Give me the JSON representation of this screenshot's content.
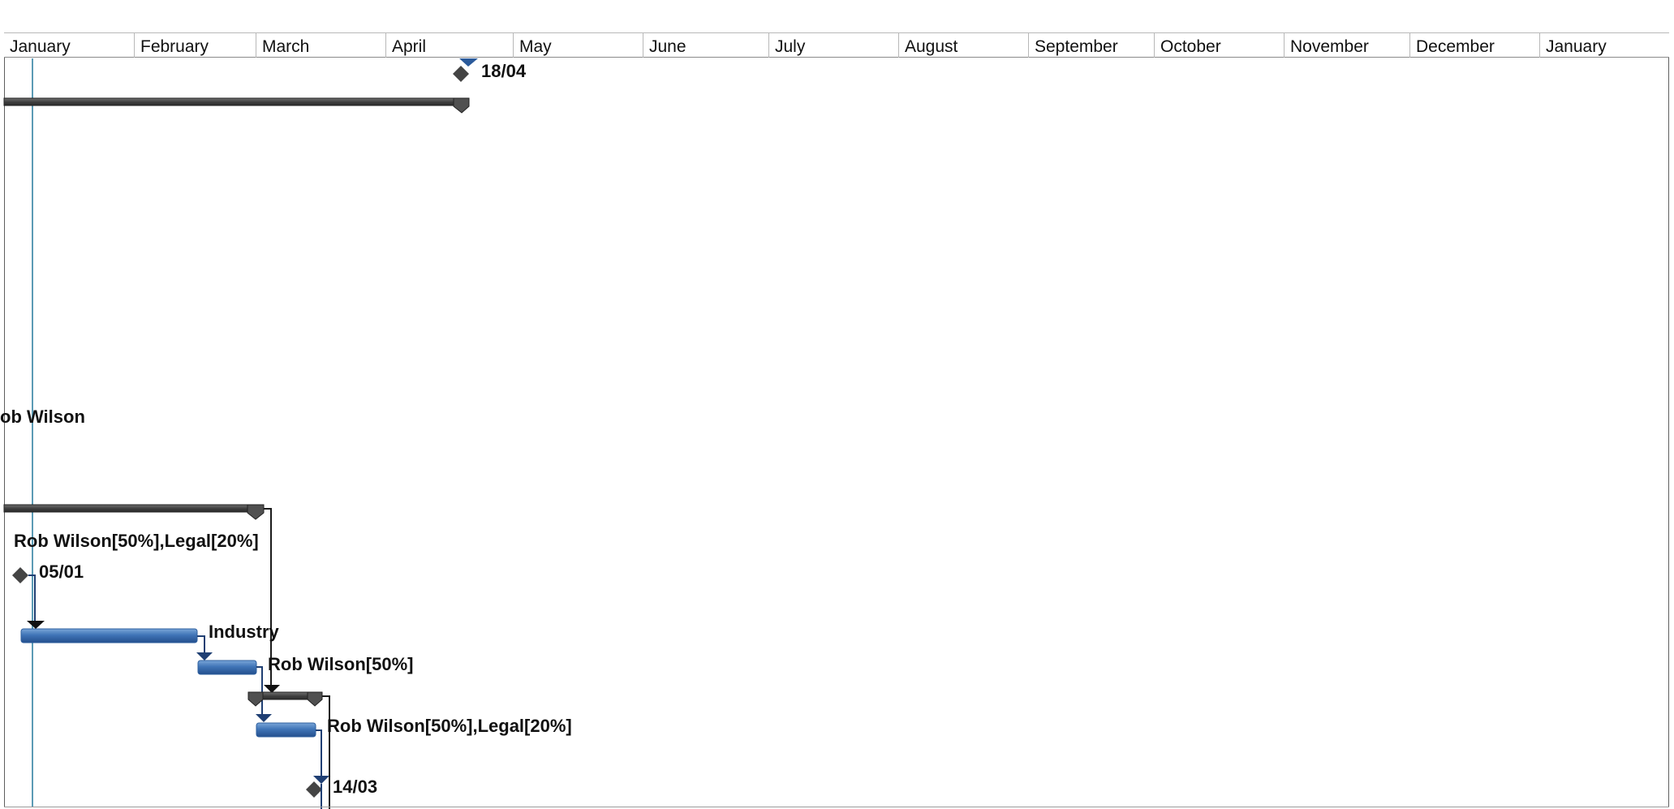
{
  "timeline": {
    "months": [
      "January",
      "February",
      "March",
      "April",
      "May",
      "June",
      "July",
      "August",
      "September",
      "October",
      "November",
      "December",
      "January"
    ]
  },
  "labels": {
    "milestone_top": "18/04",
    "partial_resource": "ob Wilson",
    "summary_resource": "Rob Wilson[50%],Legal[20%]",
    "milestone_start": "05/01",
    "task_industry": "Industry",
    "task_rob_half": "Rob Wilson[50%]",
    "task_rob_legal": "Rob Wilson[50%],Legal[20%]",
    "milestone_end": "14/03"
  },
  "colors": {
    "task_bar": "#4f81bd",
    "summary_bar": "#404040",
    "today_line": "#5b9bb5",
    "link": "#1f3f73"
  }
}
